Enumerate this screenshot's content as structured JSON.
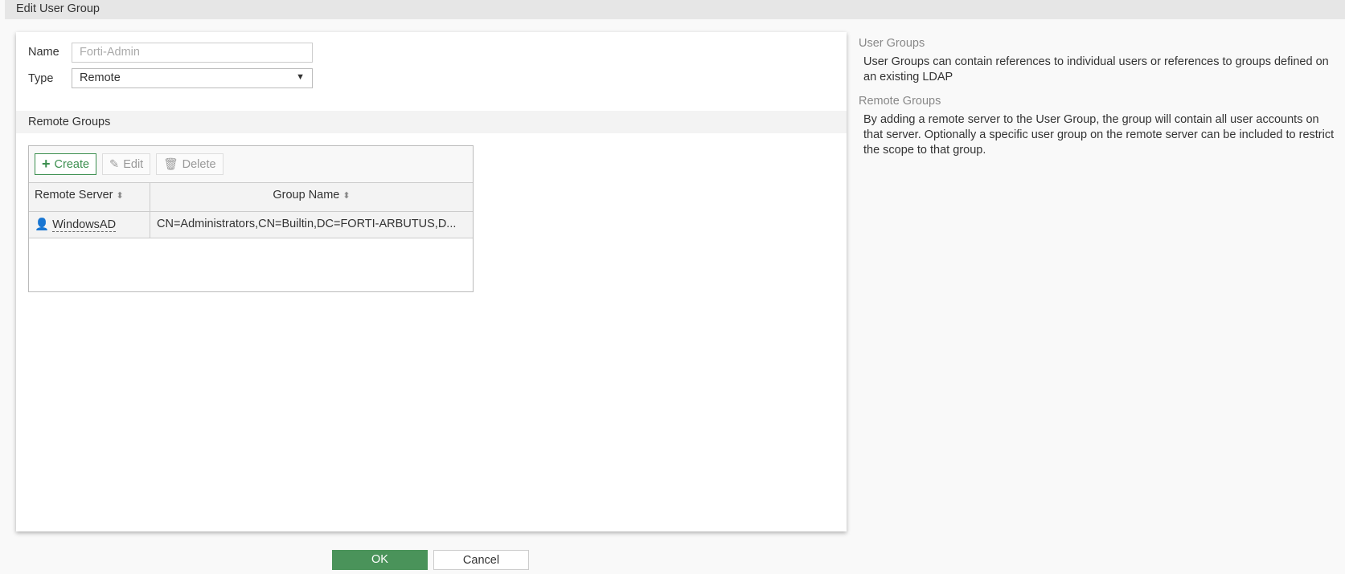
{
  "header": {
    "title": "Edit User Group"
  },
  "form": {
    "name_label": "Name",
    "name_value": "Forti-Admin",
    "type_label": "Type",
    "type_value": "Remote"
  },
  "remote_groups": {
    "title": "Remote Groups",
    "toolbar": {
      "create": "Create",
      "edit": "Edit",
      "delete": "Delete"
    },
    "columns": [
      "Remote Server",
      "Group Name"
    ],
    "rows": [
      {
        "server": "WindowsAD",
        "group": "CN=Administrators,CN=Builtin,DC=FORTI-ARBUTUS,D..."
      }
    ]
  },
  "help": {
    "title1": "User Groups",
    "text1": "User Groups can contain references to individual users or references to groups defined on an existing LDAP",
    "title2": "Remote Groups",
    "text2": "By adding a remote server to the User Group, the group will contain all user accounts on that server. Optionally a specific user group on the remote server can be included to restrict the scope to that group."
  },
  "footer": {
    "ok": "OK",
    "cancel": "Cancel"
  },
  "colors": {
    "accent": "#4a935a"
  }
}
